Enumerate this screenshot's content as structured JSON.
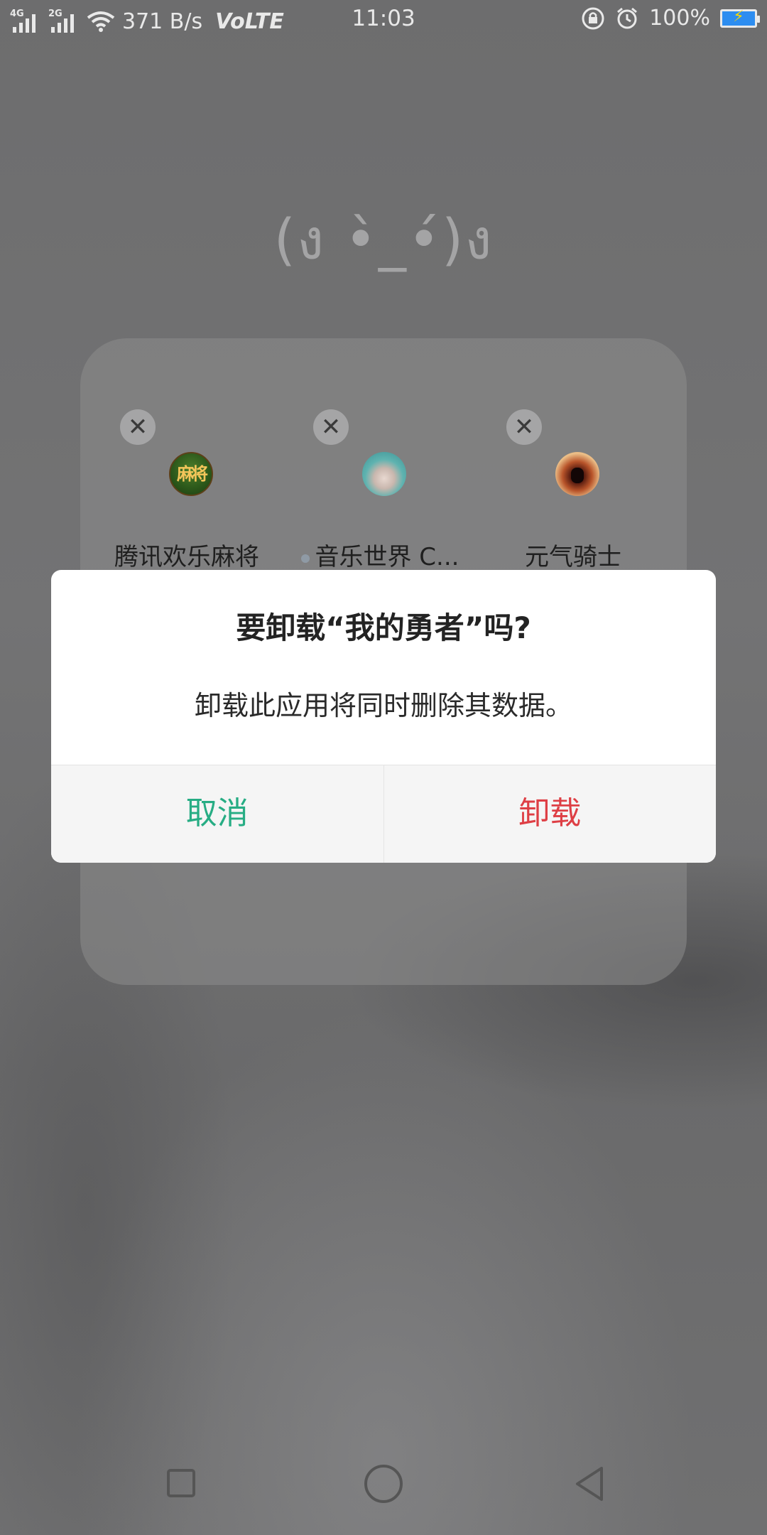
{
  "status_bar": {
    "sig1_tag": "4G",
    "sig2_tag": "2G",
    "net_speed": "371 B/s",
    "volte": "VoLTE",
    "time": "11:03",
    "battery_percent": "100%",
    "icons": [
      "signal-icon",
      "wifi-icon",
      "lock-rotation-icon",
      "alarm-icon",
      "battery-charging-icon"
    ],
    "battery_color": "#2d8df0"
  },
  "kaomoji": "(ง •̀_•́)ง",
  "folder": {
    "apps": [
      {
        "label": "腾讯欢乐麻将",
        "icon_text": "麻将",
        "has_dot": false
      },
      {
        "label": "音乐世界 C...",
        "icon_text": "",
        "has_dot": true
      },
      {
        "label": "元气骑士",
        "icon_text": "",
        "has_dot": false
      }
    ],
    "close_glyph": "✕"
  },
  "dialog": {
    "title": "要卸载“我的勇者”吗?",
    "message": "卸载此应用将同时删除其数据。",
    "cancel_label": "取消",
    "uninstall_label": "卸载",
    "cancel_color": "#27ad84",
    "uninstall_color": "#de3f45"
  },
  "navbar": {
    "icons": [
      "recent-apps-icon",
      "home-icon",
      "back-icon"
    ]
  }
}
